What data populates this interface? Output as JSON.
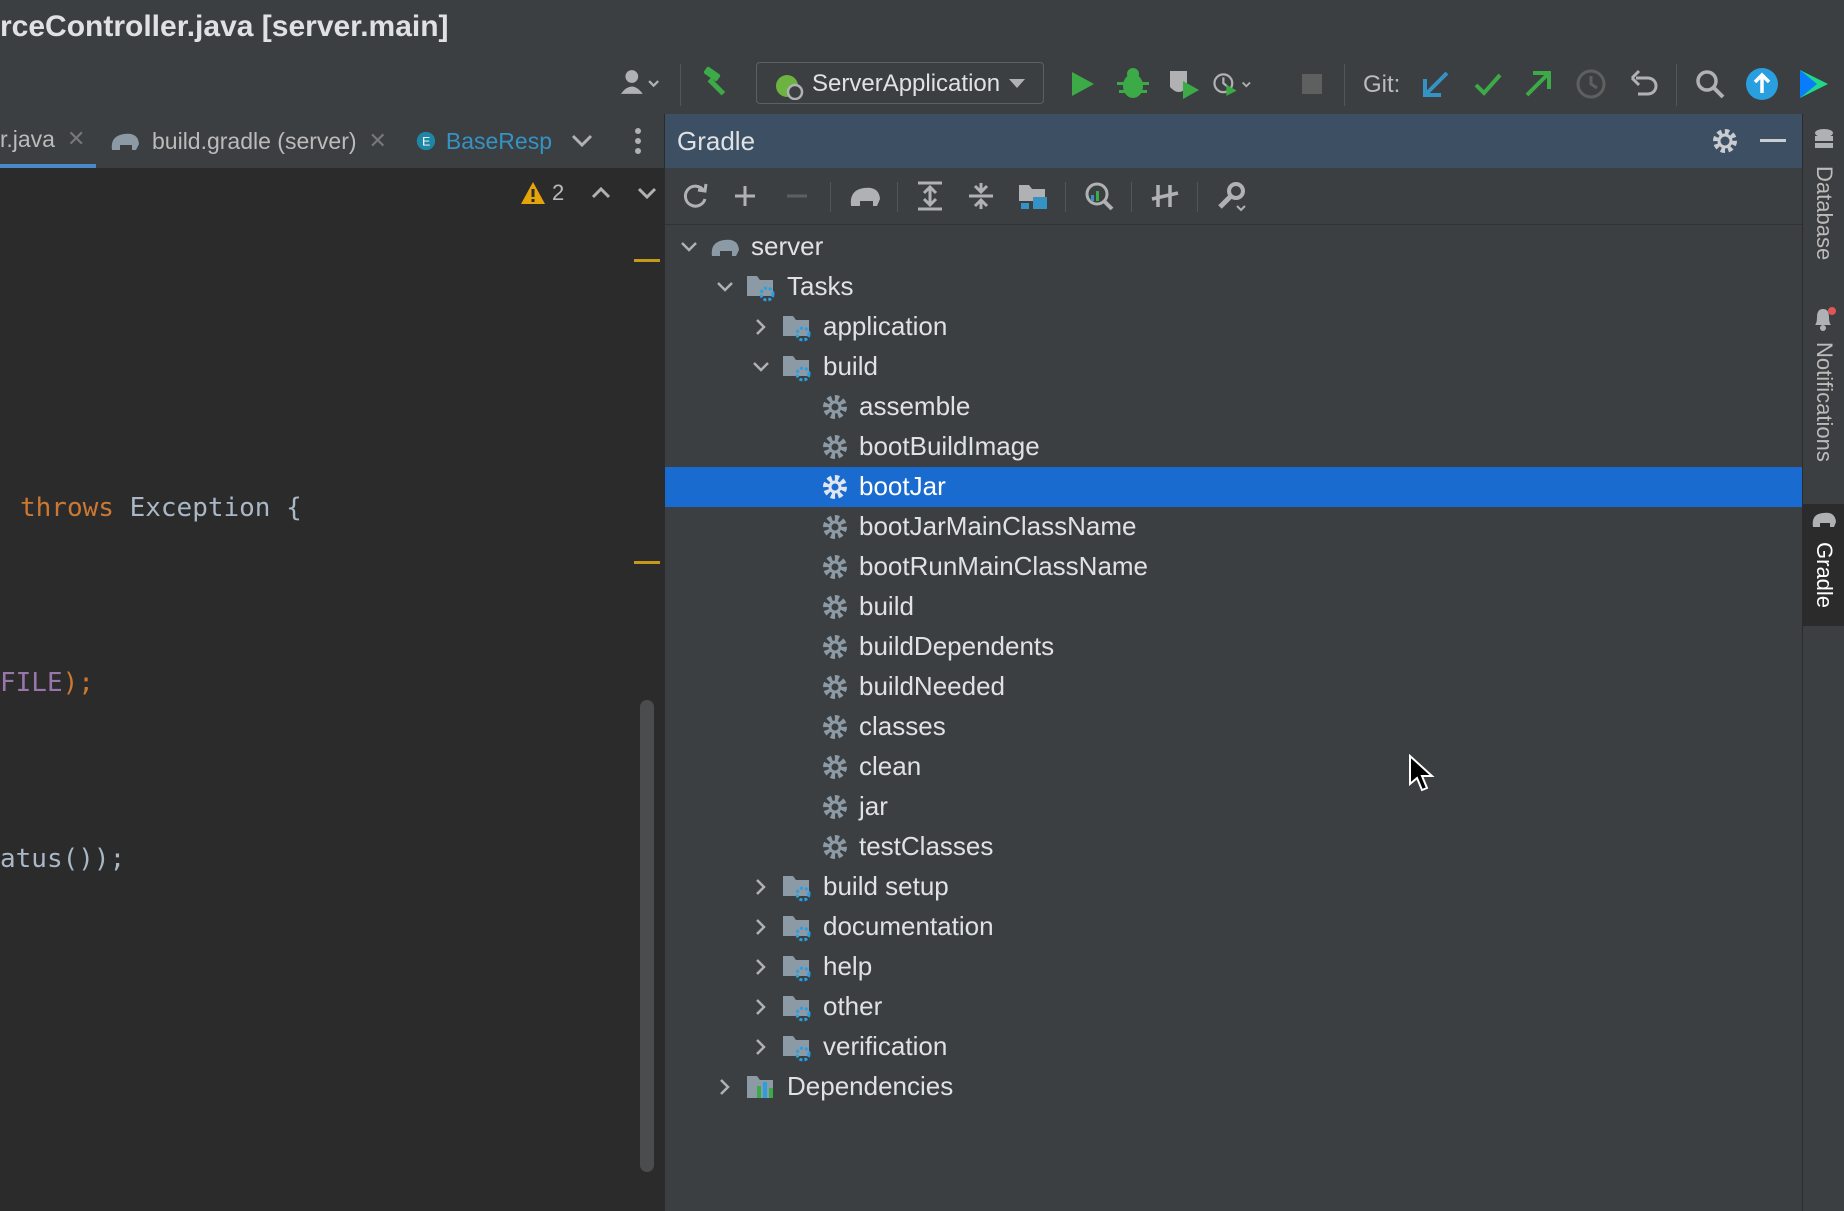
{
  "window": {
    "title": "rceController.java [server.main]"
  },
  "toolbar": {
    "run_config": "ServerApplication",
    "git_label": "Git:"
  },
  "editor": {
    "tabs": [
      {
        "label": "r.java"
      },
      {
        "label": "build.gradle (server)"
      },
      {
        "label": "BaseResp"
      }
    ],
    "warning_count": "2",
    "code_lines": {
      "throws_kw": "throws",
      "throws_rest": " Exception {",
      "file_const": "FILE",
      "file_tail": ");",
      "status_call": "atus());"
    }
  },
  "gradle": {
    "title": "Gradle",
    "tree": {
      "root": "server",
      "tasks": "Tasks",
      "application": "application",
      "build_group": "build",
      "build_tasks": [
        "assemble",
        "bootBuildImage",
        "bootJar",
        "bootJarMainClassName",
        "bootRunMainClassName",
        "build",
        "buildDependents",
        "buildNeeded",
        "classes",
        "clean",
        "jar",
        "testClasses"
      ],
      "selected_task": "bootJar",
      "groups_after": [
        "build setup",
        "documentation",
        "help",
        "other",
        "verification"
      ],
      "dependencies": "Dependencies"
    }
  },
  "sidebar_right": {
    "database": "Database",
    "notifications": "Notifications",
    "gradle": "Gradle"
  },
  "colors": {
    "selection": "#1a6bd0",
    "header": "#3d4f62",
    "run_green": "#3cab47",
    "git_blue": "#3592c4"
  },
  "icons": [
    "user-icon",
    "hammer-icon",
    "run-icon",
    "debug-icon",
    "coverage-icon",
    "profile-icon",
    "stop-icon",
    "git-update-icon",
    "git-commit-icon",
    "git-push-icon",
    "history-icon",
    "rollback-icon",
    "search-icon",
    "upgrade-icon",
    "toolbox-icon",
    "refresh-icon",
    "plus-icon",
    "minus-icon",
    "elephant-icon",
    "expand-all-icon",
    "collapse-all-icon",
    "dependencies-icon",
    "analyze-icon",
    "offline-icon",
    "wrench-icon",
    "gear-icon",
    "minimize-icon",
    "chevron-down-icon",
    "warning-icon"
  ]
}
